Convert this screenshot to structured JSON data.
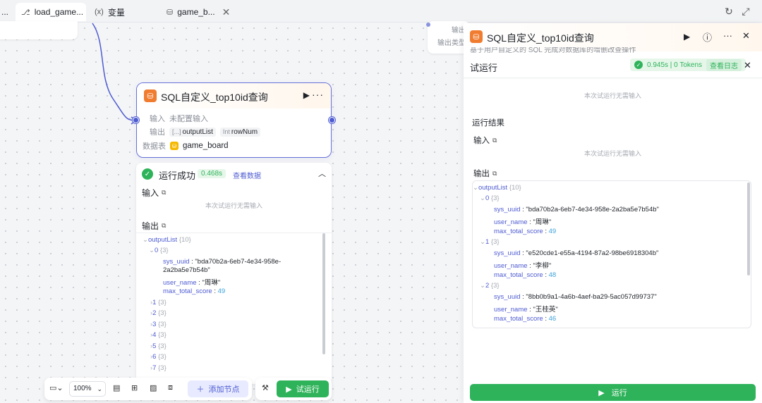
{
  "tabs": [
    {
      "label": "...",
      "icon": "workflow-icon"
    },
    {
      "label": "load_game...",
      "icon": "workflow-icon",
      "active": true
    },
    {
      "label": "变量",
      "icon": "variable-icon"
    },
    {
      "label": "game_b...",
      "icon": "database-icon"
    }
  ],
  "ghost_right": {
    "line1": "输出",
    "line2": "输出类型"
  },
  "node": {
    "title": "SQL自定义_top10id查询",
    "input_label": "输入",
    "input_value": "未配置输入",
    "output_label": "输出",
    "outputs": [
      {
        "type": "[...]",
        "name": "outputList"
      },
      {
        "type": "Int",
        "name": "rowNum"
      }
    ],
    "table_label": "数据表",
    "table_value": "game_board"
  },
  "result": {
    "status": "运行成功",
    "duration": "0.468s",
    "view_data": "查看数据",
    "input_label": "输入",
    "no_input": "本次试运行无需输入",
    "output_label": "输出",
    "tree_root": "outputList",
    "tree_root_count": "{10}",
    "item0_key": "0",
    "item0_count": "{3}",
    "sys_uuid_key": "sys_uuid",
    "sys_uuid_val": "\"bda70b2a-6eb7-4e34-958e-",
    "sys_uuid_val2": "2a2ba5e7b54b\"",
    "user_name_key": "user_name",
    "user_name_val": "\"周琳\"",
    "score_key": "max_total_score",
    "score_val": "49",
    "collapsed": [
      {
        "key": "1",
        "count": "{3}"
      },
      {
        "key": "2",
        "count": "{3}"
      },
      {
        "key": "3",
        "count": "{3}"
      },
      {
        "key": "4",
        "count": "{3}"
      },
      {
        "key": "5",
        "count": "{3}"
      },
      {
        "key": "6",
        "count": "{3}"
      },
      {
        "key": "7",
        "count": "{3}"
      }
    ]
  },
  "toolbar": {
    "zoom": "100%",
    "add_node": "添加节点",
    "trial_run": "试运行"
  },
  "panel": {
    "title": "SQL自定义_top10id查询",
    "desc": "基于用户自定义的 SQL 完成对数据库的增删改查操作",
    "test_title": "试运行",
    "stat": "0.945s | 0 Tokens",
    "view_log": "查看日志",
    "no_input_top": "本次试运行无需输入",
    "result_label": "运行结果",
    "input_label": "输入",
    "no_input": "本次试运行无需输入",
    "output_label": "输出",
    "tree_root": "outputList",
    "tree_root_count": "{10}",
    "items": [
      {
        "key": "0",
        "count": "{3}",
        "uuid": "\"bda70b2a-6eb7-4e34-958e-2a2ba5e7b54b\"",
        "name": "\"周琳\"",
        "score": "49"
      },
      {
        "key": "1",
        "count": "{3}",
        "uuid": "\"e520cde1-e55a-4194-87a2-98be6918304b\"",
        "name": "\"李柳\"",
        "score": "48"
      },
      {
        "key": "2",
        "count": "{3}",
        "uuid": "\"8bb0b9a1-4a6b-4aef-ba29-5ac057d99737\"",
        "name": "\"王桂英\"",
        "score": "46"
      }
    ],
    "sys_uuid_key": "sys_uuid",
    "user_name_key": "user_name",
    "score_key": "max_total_score",
    "run": "运行"
  },
  "colors": {
    "accent": "#4d5bd1",
    "success": "#2fb35a",
    "node_icon": "#f07c30"
  }
}
